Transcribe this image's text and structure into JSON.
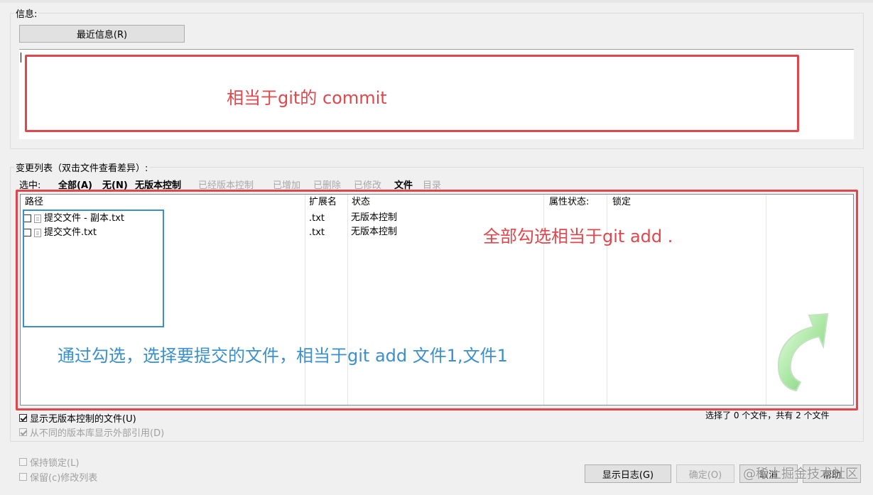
{
  "message_group": {
    "label": "信息:",
    "recent_button": "最近信息(R)",
    "annotation": "相当于git的 commit"
  },
  "changes": {
    "label": "变更列表（双击文件查看差异）:",
    "select_label": "选中:",
    "filters": [
      {
        "label": "全部(A)",
        "active": true
      },
      {
        "label": "无(N)",
        "active": true
      },
      {
        "label": "无版本控制",
        "active": true
      },
      {
        "label": "已经版本控制",
        "active": false
      },
      {
        "label": "已增加",
        "active": false
      },
      {
        "label": "已删除",
        "active": false
      },
      {
        "label": "已修改",
        "active": false
      },
      {
        "label": "文件",
        "active": true
      },
      {
        "label": "目录",
        "active": false
      }
    ],
    "columns": [
      "路径",
      "扩展名",
      "状态",
      "属性状态:",
      "锁定"
    ],
    "rows": [
      {
        "path": "提交文件 - 副本.txt",
        "ext": ".txt",
        "status": "无版本控制",
        "checked": false
      },
      {
        "path": "提交文件.txt",
        "ext": ".txt",
        "status": "无版本控制",
        "checked": false
      }
    ],
    "annotation_all": "全部勾选相当于git add .",
    "annotation_select": "通过勾选，选择要提交的文件，相当于git add 文件1,文件1",
    "summary": "选择了 0 个文件，共有 2 个文件"
  },
  "options": {
    "show_unversioned": "显示无版本控制的文件(U)",
    "show_externals": "从不同的版本库显示外部引用(D)",
    "keep_locks": "保持锁定(L)",
    "keep_changelists": "保留(c)修改列表"
  },
  "buttons": {
    "show_log": "显示日志(G)",
    "ok": "确定(O)",
    "cancel": "取消",
    "help": "帮助"
  },
  "watermark": "@稀土掘金技术社区",
  "colors": {
    "annotation_red": "#e0474c",
    "annotation_blue": "#3b8fcd",
    "arrow_green": "#7fd67a"
  }
}
